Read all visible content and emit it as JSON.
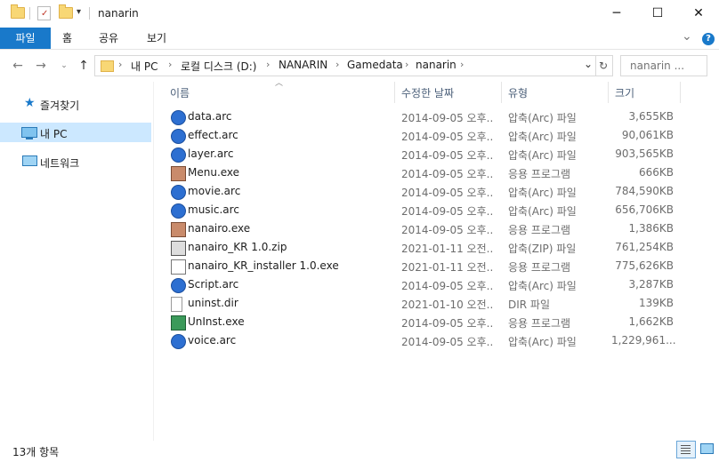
{
  "window": {
    "title": "nanarin",
    "minimize_glyph": "─",
    "maximize_glyph": "☐",
    "close_glyph": "✕"
  },
  "ribbon": {
    "tabs": [
      "파일",
      "홈",
      "공유",
      "보기"
    ],
    "expand_glyph": "⌄",
    "help_glyph": "?"
  },
  "address": {
    "crumbs": [
      "내 PC",
      "로컬 디스크 (D:)",
      "NANARIN",
      "Gamedata",
      "nanarin"
    ],
    "search_placeholder": "nanarin ..."
  },
  "nav": {
    "items": [
      {
        "label": "즐겨찾기",
        "icon": "star-icon"
      },
      {
        "label": "내 PC",
        "icon": "computer-icon",
        "selected": true
      },
      {
        "label": "네트워크",
        "icon": "network-icon"
      }
    ]
  },
  "columns": [
    "이름",
    "수정한 날짜",
    "유형",
    "크기"
  ],
  "files": [
    {
      "name": "data.arc",
      "date": "2014-09-05 오후...",
      "type": "압축(Arc) 파일",
      "size": "3,655KB",
      "icon": "arc-file-icon"
    },
    {
      "name": "effect.arc",
      "date": "2014-09-05 오후...",
      "type": "압축(Arc) 파일",
      "size": "90,061KB",
      "icon": "arc-file-icon"
    },
    {
      "name": "layer.arc",
      "date": "2014-09-05 오후...",
      "type": "압축(Arc) 파일",
      "size": "903,565KB",
      "icon": "arc-file-icon"
    },
    {
      "name": "Menu.exe",
      "date": "2014-09-05 오후...",
      "type": "응용 프로그램",
      "size": "666KB",
      "icon": "game-exe-icon"
    },
    {
      "name": "movie.arc",
      "date": "2014-09-05 오후...",
      "type": "압축(Arc) 파일",
      "size": "784,590KB",
      "icon": "arc-file-icon"
    },
    {
      "name": "music.arc",
      "date": "2014-09-05 오후...",
      "type": "압축(Arc) 파일",
      "size": "656,706KB",
      "icon": "arc-file-icon"
    },
    {
      "name": "nanairo.exe",
      "date": "2014-09-05 오후...",
      "type": "응용 프로그램",
      "size": "1,386KB",
      "icon": "game-exe-icon"
    },
    {
      "name": "nanairo_KR 1.0.zip",
      "date": "2021-01-11 오전...",
      "type": "압축(ZIP) 파일",
      "size": "761,254KB",
      "icon": "zip-file-icon"
    },
    {
      "name": "nanairo_KR_installer 1.0.exe",
      "date": "2021-01-11 오전...",
      "type": "응용 프로그램",
      "size": "775,626KB",
      "icon": "installer-icon"
    },
    {
      "name": "Script.arc",
      "date": "2014-09-05 오후...",
      "type": "압축(Arc) 파일",
      "size": "3,287KB",
      "icon": "arc-file-icon"
    },
    {
      "name": "uninst.dir",
      "date": "2021-01-10 오전...",
      "type": "DIR 파일",
      "size": "139KB",
      "icon": "blank-file-icon"
    },
    {
      "name": "UnInst.exe",
      "date": "2014-09-05 오후...",
      "type": "응용 프로그램",
      "size": "1,662KB",
      "icon": "uninstaller-icon"
    },
    {
      "name": "voice.arc",
      "date": "2014-09-05 오후...",
      "type": "압축(Arc) 파일",
      "size": "1,229,961...",
      "icon": "arc-file-icon"
    }
  ],
  "status": {
    "count": "13개 항목"
  },
  "colors": {
    "accent": "#1979ca",
    "selection": "#cce8ff",
    "header_text": "#4c607a"
  }
}
